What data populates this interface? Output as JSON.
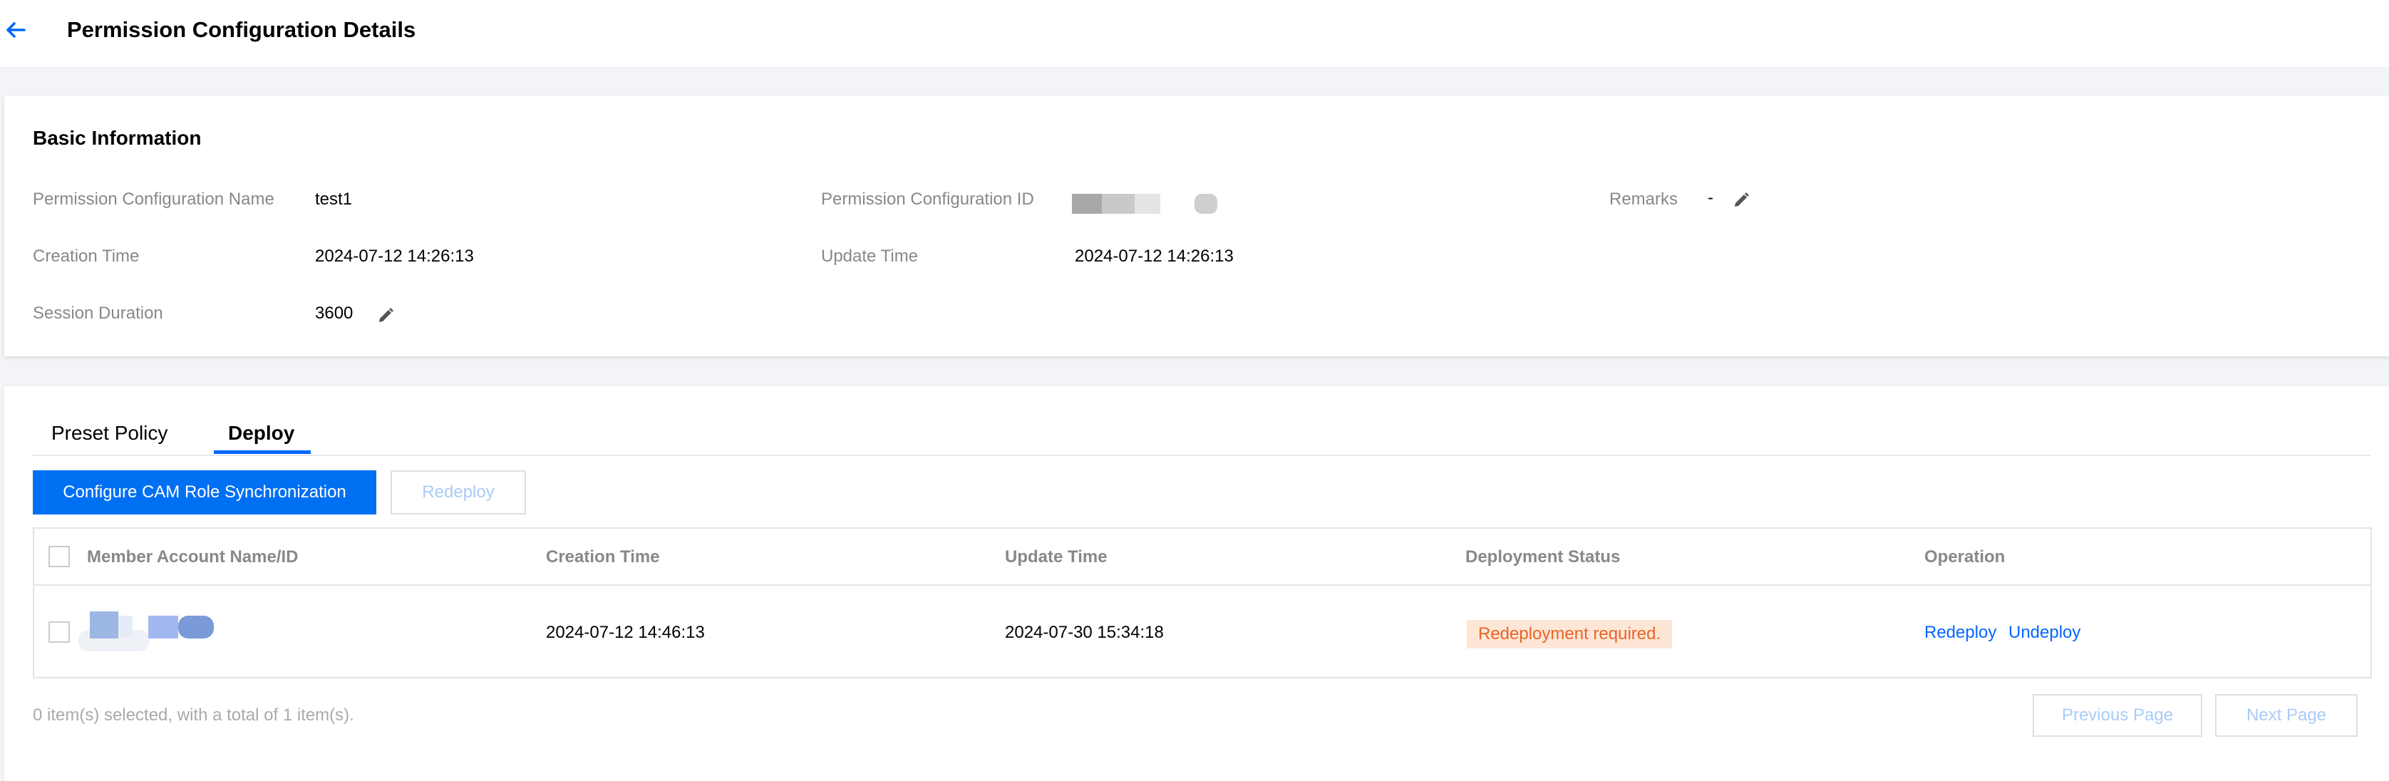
{
  "header": {
    "title": "Permission Configuration Details"
  },
  "basic_info": {
    "title": "Basic Information",
    "fields": {
      "config_name": {
        "label": "Permission Configuration Name",
        "value": "test1"
      },
      "config_id": {
        "label": "Permission Configuration ID",
        "value": ""
      },
      "remarks": {
        "label": "Remarks",
        "value": "-"
      },
      "creation_time": {
        "label": "Creation Time",
        "value": "2024-07-12 14:26:13"
      },
      "update_time": {
        "label": "Update Time",
        "value": "2024-07-12 14:26:13"
      },
      "session_duration": {
        "label": "Session Duration",
        "value": "3600"
      }
    }
  },
  "tabs": [
    {
      "label": "Preset Policy",
      "active": false
    },
    {
      "label": "Deploy",
      "active": true
    }
  ],
  "toolbar": {
    "configure_label": "Configure CAM Role Synchronization",
    "redeploy_label": "Redeploy"
  },
  "table": {
    "columns": [
      "Member Account Name/ID",
      "Creation Time",
      "Update Time",
      "Deployment Status",
      "Operation"
    ],
    "rows": [
      {
        "member": "",
        "creation_time": "2024-07-12 14:46:13",
        "update_time": "2024-07-30 15:34:18",
        "status": "Redeployment required.",
        "operations": [
          "Redeploy",
          "Undeploy"
        ]
      }
    ]
  },
  "footer": {
    "selection_text": "0 item(s) selected, with a total of 1 item(s).",
    "prev_label": "Previous Page",
    "next_label": "Next Page"
  },
  "colors": {
    "accent": "#0070f3",
    "status_bg": "#fde6d5",
    "status_text": "#e8642a"
  },
  "icons": {
    "back": "arrow-left-icon",
    "edit": "pencil-icon"
  }
}
